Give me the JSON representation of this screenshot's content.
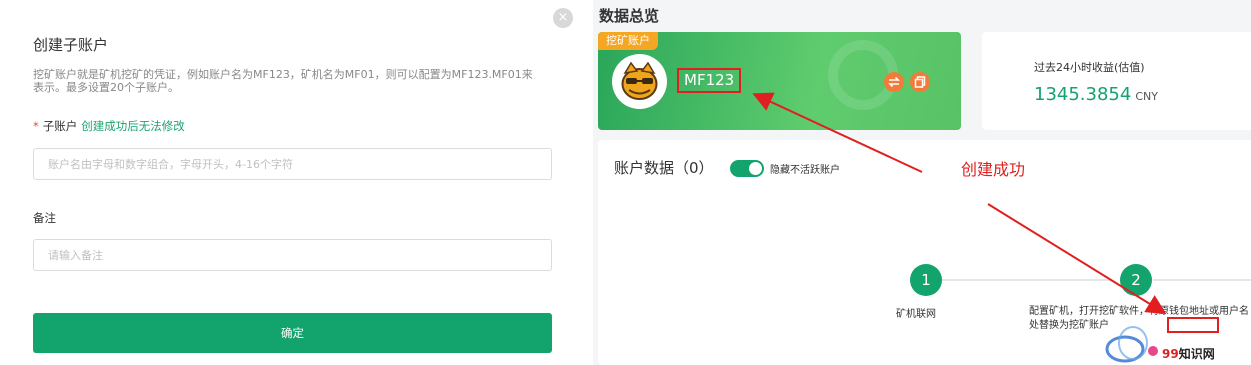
{
  "modal": {
    "title": "创建子账户",
    "description": "挖矿账户就是矿机挖矿的凭证，例如账户名为MF123，矿机名为MF01，则可以配置为MF123.MF01来表示。最多设置20个子账户。",
    "sub_account_required_mark": "*",
    "sub_account_label": "子账户",
    "sub_account_hint": "创建成功后无法修改",
    "sub_account_placeholder": "账户名由字母和数字组合，字母开头，4-16个字符",
    "note_label": "备注",
    "note_placeholder": "请输入备注",
    "confirm_label": "确定",
    "close_icon": "×"
  },
  "dashboard": {
    "title": "数据总览",
    "account_card": {
      "tag": "挖矿账户",
      "name": "MF123",
      "avatar_icon": "mascot-avatar",
      "icons": [
        "swap-icon",
        "copy-icon"
      ]
    },
    "income": {
      "label": "过去24小时收益(估值)",
      "value": "1345.3854",
      "unit": "CNY"
    },
    "account_data": {
      "label": "账户数据（0）",
      "toggle_on": true,
      "toggle_label": "隐藏不活跃账户"
    },
    "steps": [
      {
        "number": "1",
        "text": "矿机联网"
      },
      {
        "number": "2",
        "text": "配置矿机，打开挖矿软件，将原钱包地址或用户名处替换为挖矿账户"
      }
    ]
  },
  "annotation": {
    "text": "创建成功",
    "color": "#e02020"
  },
  "watermark": {
    "prefix": "99",
    "name": "知识网"
  },
  "colors": {
    "brand_green": "#13a36d",
    "tag_orange": "#f5a623",
    "icon_orange": "#f27b3a",
    "annotation_red": "#e02020"
  }
}
